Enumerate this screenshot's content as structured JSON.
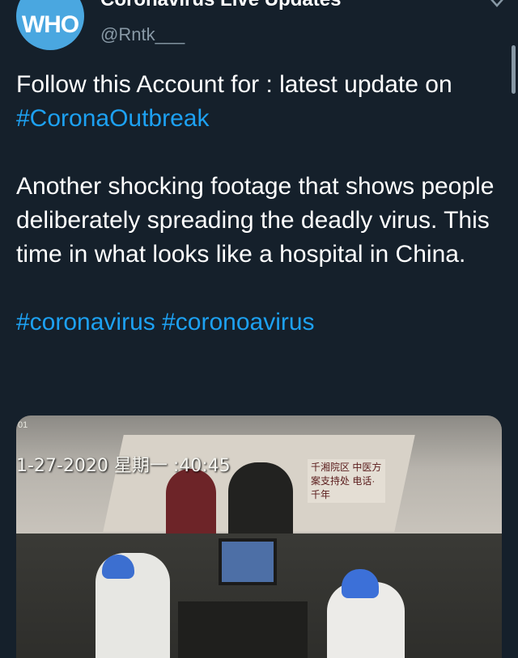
{
  "header": {
    "display_name": "Coronavirus Live Updates",
    "handle": "@Rntk___",
    "avatar_text": "WHO"
  },
  "tweet": {
    "line1_prefix": "Follow this Account for : latest update on ",
    "line1_hashtag": "#CoronaOutbreak",
    "line2": "Another shocking footage that shows people deliberately spreading the deadly virus. This time in what looks like a hospital in China.",
    "hashtags": [
      "#coronavirus",
      "#coronoavirus"
    ]
  },
  "media": {
    "timestamp": "1-27-2020 星期一 :40:45",
    "corner_label": "01",
    "sign_text": "千湘院区 中医方案支持处 电话·千年"
  },
  "colors": {
    "background": "#15202b",
    "text": "#ffffff",
    "muted": "#8899a6",
    "link": "#1da1f2"
  },
  "icons": {
    "more": "chevron-down-icon"
  }
}
